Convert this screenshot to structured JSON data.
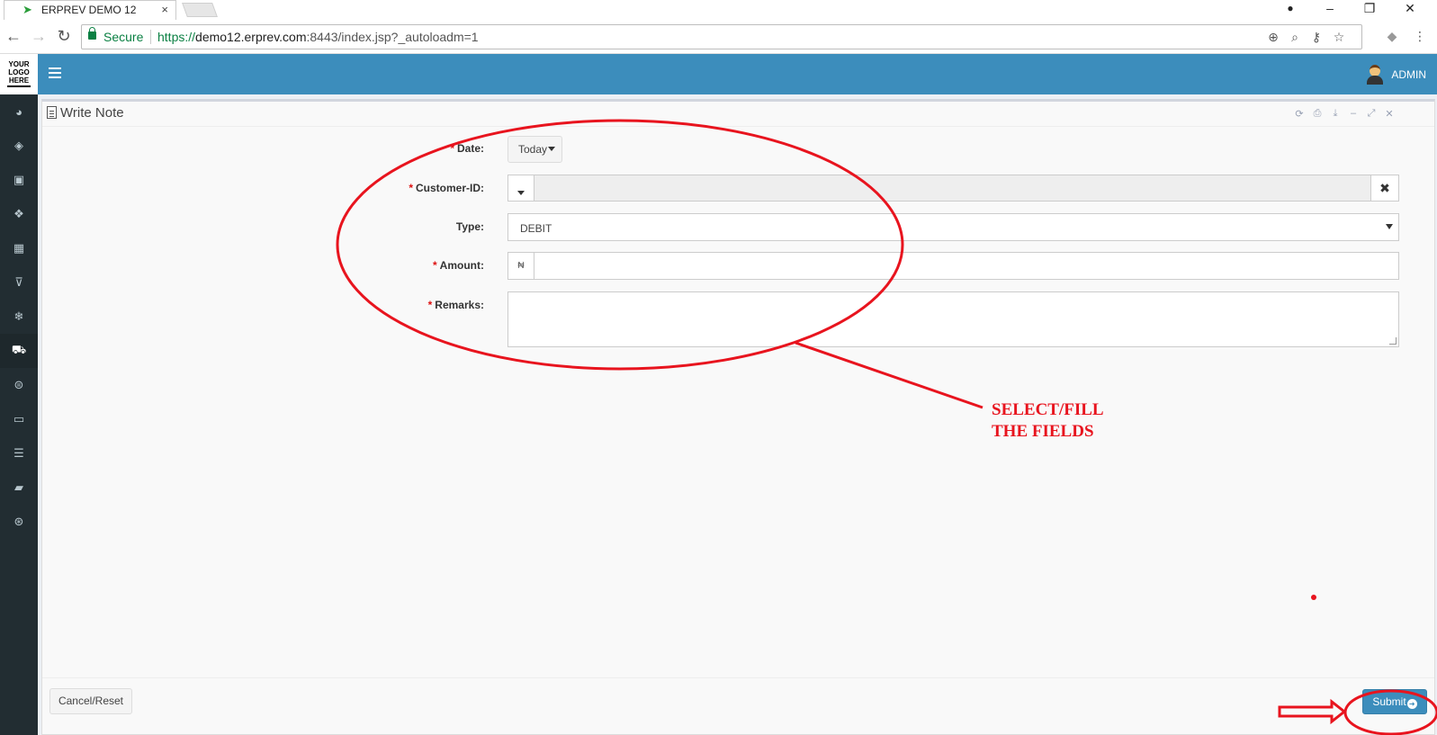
{
  "browser": {
    "tab_title": "ERPREV DEMO 12",
    "tab_close": "×",
    "secure_label": "Secure",
    "url_scheme": "https://",
    "url_host": "demo12.erprev.com",
    "url_path": ":8443/index.jsp?_autoloadm=1",
    "window_controls": [
      "–",
      "❐",
      "✕"
    ]
  },
  "header": {
    "logo_lines": [
      "YOUR",
      "LOGO",
      "HERE"
    ],
    "user_name": "ADMIN"
  },
  "sidebar": {
    "icons": [
      "dashboard-icon",
      "tag-icon",
      "money-icon",
      "cubes-icon",
      "building-icon",
      "trash-icon",
      "snowflake-icon",
      "cart-icon",
      "circle-icon",
      "desktop-icon",
      "database-icon",
      "book-icon",
      "lifebuoy-icon"
    ],
    "active_index": 7
  },
  "panel": {
    "title": "Write Note",
    "tools": [
      "⟳",
      "⎙",
      "⤓",
      "–",
      "⤢",
      "✕"
    ]
  },
  "form": {
    "required_mark": "*",
    "date_label": "Date:",
    "date_value": "Today",
    "customer_label": "Customer-ID:",
    "customer_value": "",
    "customer_clear": "✖",
    "type_label": "Type:",
    "type_value": "DEBIT",
    "amount_label": "Amount:",
    "amount_symbol": "₦",
    "amount_value": "",
    "remarks_label": "Remarks:",
    "remarks_value": ""
  },
  "footer": {
    "cancel_label": "Cancel/Reset",
    "submit_label": "Submit",
    "submit_icon": "➜"
  },
  "annotation": {
    "line1": "SELECT/FILL",
    "line2": "THE FIELDS",
    "color": "#e8141e"
  }
}
